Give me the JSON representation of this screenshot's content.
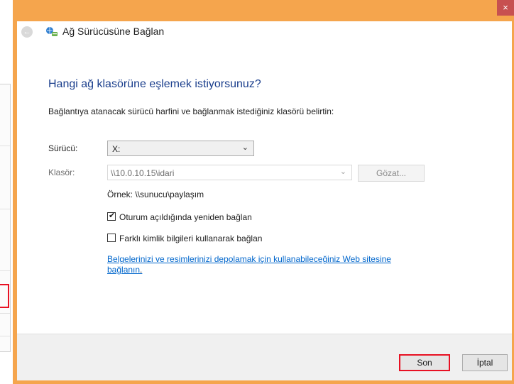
{
  "window": {
    "title": "Ağ Sürücüsüne Bağlan",
    "close_glyph": "×",
    "back_glyph": "←"
  },
  "content": {
    "heading": "Hangi ağ klasörüne eşlemek istiyorsunuz?",
    "intro": "Bağlantıya atanacak sürücü harfini ve bağlanmak istediğiniz klasörü belirtin:",
    "drive_label": "Sürücü:",
    "drive_value": "X:",
    "folder_label": "Klasör:",
    "folder_value": "\\\\10.0.10.15\\idari",
    "browse_label": "Gözat...",
    "example": "Örnek: \\\\sunucu\\paylaşım",
    "reconnect_label": "Oturum açıldığında yeniden bağlan",
    "reconnect_checked": true,
    "credentials_label": "Farklı kimlik bilgileri kullanarak bağlan",
    "credentials_checked": false,
    "link_line1": "Belgelerinizi ve resimlerinizi depolamak için kullanabileceğiniz Web sitesine",
    "link_line2": "bağlanın",
    "link_trailing": "."
  },
  "footer": {
    "finish_label": "Son",
    "cancel_label": "İptal"
  },
  "icons": {
    "back": "back-arrow-icon",
    "network": "network-drive-icon",
    "close": "close-icon",
    "dropdown": "chevron-down-icon",
    "check": "checkmark-icon"
  },
  "colors": {
    "frame": "#f5a54d",
    "heading": "#1a3e8c",
    "link": "#0066cc",
    "highlight": "#e81123"
  }
}
